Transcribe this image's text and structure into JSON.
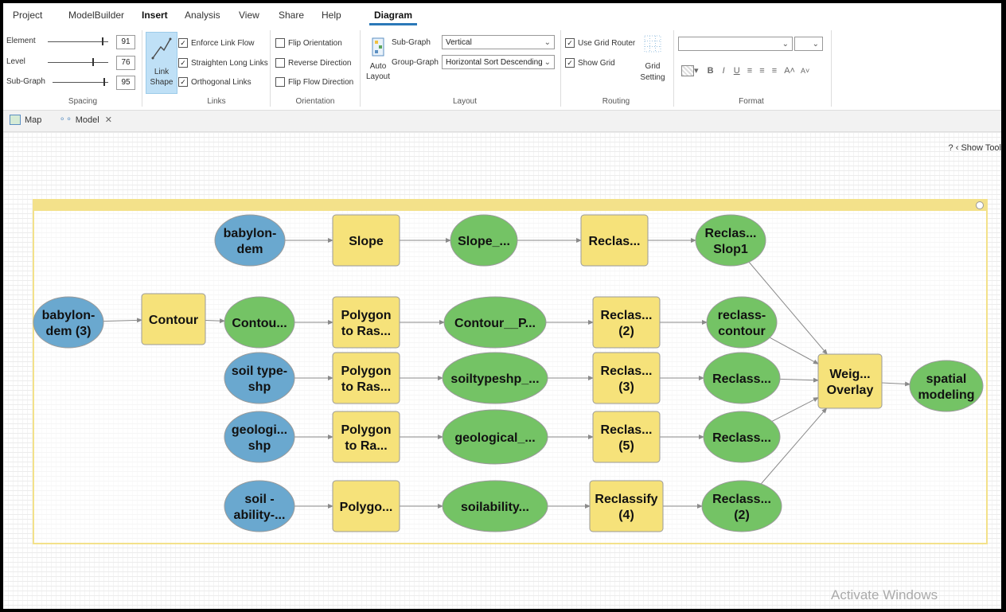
{
  "menu": {
    "items": [
      "Project",
      "ModelBuilder",
      "Insert",
      "Analysis",
      "View",
      "Share",
      "Help",
      "Diagram"
    ]
  },
  "ribbon": {
    "spacing": {
      "title": "Spacing",
      "rows": [
        {
          "label": "Element",
          "value": "91"
        },
        {
          "label": "Level",
          "value": "76"
        },
        {
          "label": "Sub-Graph",
          "value": "95"
        }
      ]
    },
    "links": {
      "title": "Links",
      "link_shape_label_1": "Link",
      "link_shape_label_2": "Shape",
      "options": [
        {
          "label": "Enforce Link Flow",
          "checked": true
        },
        {
          "label": "Straighten Long Links",
          "checked": true
        },
        {
          "label": "Orthogonal Links",
          "checked": true
        }
      ]
    },
    "orientation": {
      "title": "Orientation",
      "options": [
        {
          "label": "Flip Orientation",
          "checked": false
        },
        {
          "label": "Reverse Direction",
          "checked": false
        },
        {
          "label": "Flip Flow Direction",
          "checked": false
        }
      ]
    },
    "layout": {
      "title": "Layout",
      "auto_layout_1": "Auto",
      "auto_layout_2": "Layout",
      "sub_graph_label": "Sub-Graph",
      "sub_graph_value": "Vertical",
      "group_graph_label": "Group-Graph",
      "group_graph_value": "Horizontal Sort Descending"
    },
    "routing": {
      "title": "Routing",
      "use_grid_router": "Use Grid Router",
      "show_grid": "Show Grid",
      "grid_setting_1": "Grid",
      "grid_setting_2": "Setting"
    },
    "format": {
      "title": "Format",
      "font_value": "",
      "size_value": ""
    }
  },
  "tabs": [
    {
      "label": "Map"
    },
    {
      "label": "Model"
    }
  ],
  "canvas": {
    "show_tools": "? ‹ Show Tool",
    "watermark": "Activate Windows"
  },
  "model": {
    "nodes": [
      {
        "id": "n1",
        "lines": [
          "babylon-",
          "dem"
        ],
        "kind": "input"
      },
      {
        "id": "n2",
        "lines": [
          "Slope"
        ],
        "kind": "tool"
      },
      {
        "id": "n3",
        "lines": [
          "Slope_..."
        ],
        "kind": "output"
      },
      {
        "id": "n4",
        "lines": [
          "Reclas..."
        ],
        "kind": "tool"
      },
      {
        "id": "n5",
        "lines": [
          "Reclas...",
          "Slop1"
        ],
        "kind": "output"
      },
      {
        "id": "n6",
        "lines": [
          "babylon-",
          "dem (3)"
        ],
        "kind": "input"
      },
      {
        "id": "n7",
        "lines": [
          "Contour"
        ],
        "kind": "tool"
      },
      {
        "id": "n8",
        "lines": [
          "Contou..."
        ],
        "kind": "output"
      },
      {
        "id": "n9",
        "lines": [
          "Polygon",
          "to Ras..."
        ],
        "kind": "tool"
      },
      {
        "id": "n10",
        "lines": [
          "Contour__P..."
        ],
        "kind": "output"
      },
      {
        "id": "n11",
        "lines": [
          "Reclas...",
          "(2)"
        ],
        "kind": "tool"
      },
      {
        "id": "n12",
        "lines": [
          "reclass-",
          "contour"
        ],
        "kind": "output"
      },
      {
        "id": "n13",
        "lines": [
          "soil type-",
          "shp"
        ],
        "kind": "input"
      },
      {
        "id": "n14",
        "lines": [
          "Polygon",
          "to Ras..."
        ],
        "kind": "tool"
      },
      {
        "id": "n15",
        "lines": [
          "soiltypeshp_..."
        ],
        "kind": "output"
      },
      {
        "id": "n16",
        "lines": [
          "Reclas...",
          "(3)"
        ],
        "kind": "tool"
      },
      {
        "id": "n17",
        "lines": [
          "Reclass..."
        ],
        "kind": "output"
      },
      {
        "id": "n18",
        "lines": [
          "geologi...",
          "shp"
        ],
        "kind": "input"
      },
      {
        "id": "n19",
        "lines": [
          "Polygon",
          "to Ra..."
        ],
        "kind": "tool"
      },
      {
        "id": "n20",
        "lines": [
          "geological_..."
        ],
        "kind": "output"
      },
      {
        "id": "n21",
        "lines": [
          "Reclas...",
          "(5)"
        ],
        "kind": "tool"
      },
      {
        "id": "n22",
        "lines": [
          "Reclass..."
        ],
        "kind": "output"
      },
      {
        "id": "n23",
        "lines": [
          "soil -",
          "ability-..."
        ],
        "kind": "input"
      },
      {
        "id": "n24",
        "lines": [
          "Polygo..."
        ],
        "kind": "tool"
      },
      {
        "id": "n25",
        "lines": [
          "soilability..."
        ],
        "kind": "output"
      },
      {
        "id": "n26",
        "lines": [
          "Reclassify",
          "(4)"
        ],
        "kind": "tool"
      },
      {
        "id": "n27",
        "lines": [
          "Reclass...",
          "(2)"
        ],
        "kind": "output"
      },
      {
        "id": "n28",
        "lines": [
          "Weig...",
          "Overlay"
        ],
        "kind": "tool"
      },
      {
        "id": "n29",
        "lines": [
          "spatial",
          "modeling"
        ],
        "kind": "output"
      }
    ],
    "links": [
      [
        "n1",
        "n2"
      ],
      [
        "n2",
        "n3"
      ],
      [
        "n3",
        "n4"
      ],
      [
        "n4",
        "n5"
      ],
      [
        "n6",
        "n7"
      ],
      [
        "n7",
        "n8"
      ],
      [
        "n8",
        "n9"
      ],
      [
        "n9",
        "n10"
      ],
      [
        "n10",
        "n11"
      ],
      [
        "n11",
        "n12"
      ],
      [
        "n13",
        "n14"
      ],
      [
        "n14",
        "n15"
      ],
      [
        "n15",
        "n16"
      ],
      [
        "n16",
        "n17"
      ],
      [
        "n18",
        "n19"
      ],
      [
        "n19",
        "n20"
      ],
      [
        "n20",
        "n21"
      ],
      [
        "n21",
        "n22"
      ],
      [
        "n23",
        "n24"
      ],
      [
        "n24",
        "n25"
      ],
      [
        "n25",
        "n26"
      ],
      [
        "n26",
        "n27"
      ],
      [
        "n5",
        "n28"
      ],
      [
        "n12",
        "n28"
      ],
      [
        "n17",
        "n28"
      ],
      [
        "n22",
        "n28"
      ],
      [
        "n27",
        "n28"
      ],
      [
        "n28",
        "n29"
      ]
    ],
    "colors": {
      "input": "#6aa8cf",
      "tool": "#f6e27a",
      "output": "#74c365",
      "link": "#8a8a8a"
    }
  }
}
